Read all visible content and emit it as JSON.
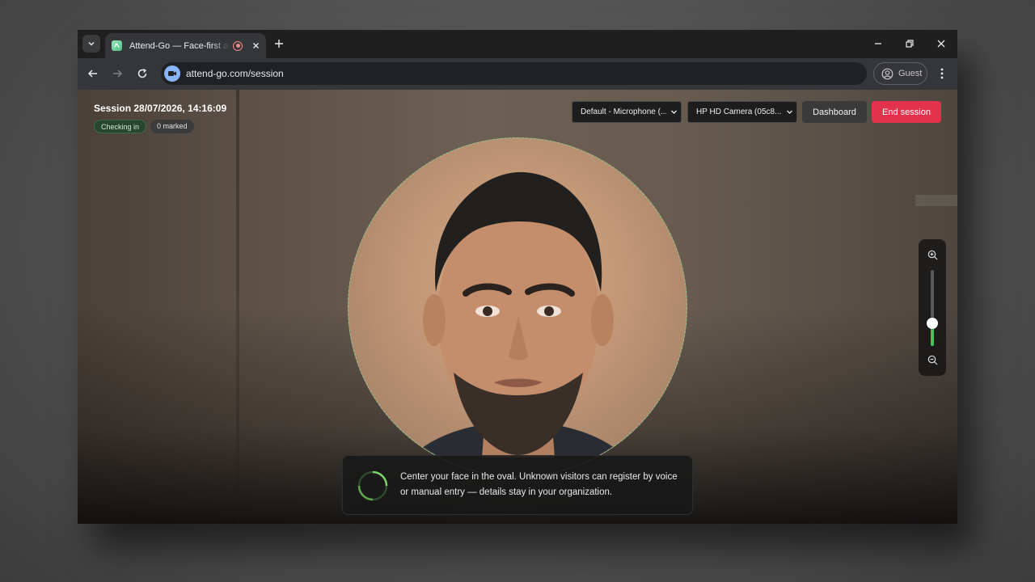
{
  "browser": {
    "tab": {
      "title": "Attend-Go — Face-first attendance"
    },
    "url": "attend-go.com/session",
    "profile_label": "Guest"
  },
  "session": {
    "title": "Session 28/07/2026, 14:16:09",
    "status_badge": "Checking in",
    "marked_badge": "0 marked"
  },
  "controls": {
    "microphone_select": "Default - Microphone (...",
    "camera_select": "HP HD Camera (05c8...",
    "dashboard_label": "Dashboard",
    "end_session_label": "End session"
  },
  "zoom": {
    "level": 0.3
  },
  "hint": {
    "text": "Center your face in the oval. Unknown visitors can register by voice or manual entry — details stay in your organization."
  },
  "colors": {
    "accent_green": "#43c35a",
    "danger_red": "#e3324c",
    "oval_border": "#92c98e"
  },
  "icons": {
    "tab_list": "chevron-down-icon",
    "favicon": "attend-go-favicon",
    "recording": "recording-icon",
    "close_tab": "close-icon",
    "new_tab": "plus-icon",
    "minimize": "minimize-icon",
    "restore": "restore-icon",
    "close_window": "close-icon",
    "back": "arrow-left-icon",
    "forward": "arrow-right-icon",
    "reload": "reload-icon",
    "site_info": "camera-icon",
    "profile": "profile-icon",
    "menu": "kebab-icon",
    "zoom_in": "zoom-in-icon",
    "zoom_out": "zoom-out-icon",
    "spinner": "spinner-icon"
  }
}
